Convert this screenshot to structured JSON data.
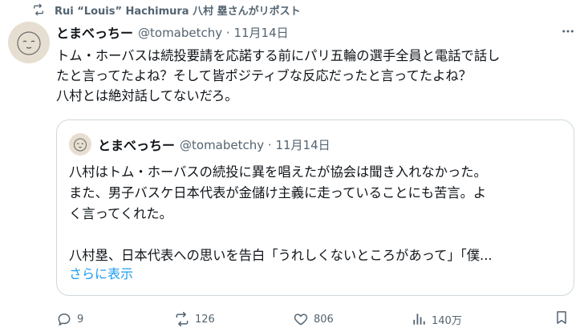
{
  "repost": {
    "text": "Rui “Louis” Hachimura 八村 塁さんがリポスト"
  },
  "tweet": {
    "display_name": "とまべっちー",
    "handle_date": "@tomabetchy · 11月14日",
    "lines": [
      "トム・ホーバスは続投要請を応諾する前にパリ五輪の選手全員と電話で話し",
      "たと言ってたよね？そして皆ポジティブな反応だったと言ってたよね？",
      "八村とは絶対話してないだろ。"
    ]
  },
  "quote": {
    "display_name": "とまべっちー",
    "handle_date": "@tomabetchy · 11月14日",
    "lines": [
      "八村はトム・ホーバスの続投に異を唱えたが協会は聞き入れなかった。",
      "また、男子バスケ日本代表が金儲け主義に走っていることにも苦言。よ",
      "く言ってくれた。",
      "",
      "八村塁、日本代表への思いを告白「うれしくないところがあって」「僕..."
    ],
    "show_more": "さらに表示"
  },
  "actions": {
    "replies": "9",
    "reposts": "126",
    "likes": "806",
    "views": "140万"
  },
  "icons": {
    "repost": "repost-icon",
    "reply": "reply-icon",
    "like": "heart-icon",
    "views": "views-icon",
    "bookmark": "bookmark-icon",
    "more": "more-icon"
  },
  "colors": {
    "link": "#1d9bf0",
    "muted": "#536471",
    "text": "#0f1419",
    "border": "#cfd9de"
  }
}
